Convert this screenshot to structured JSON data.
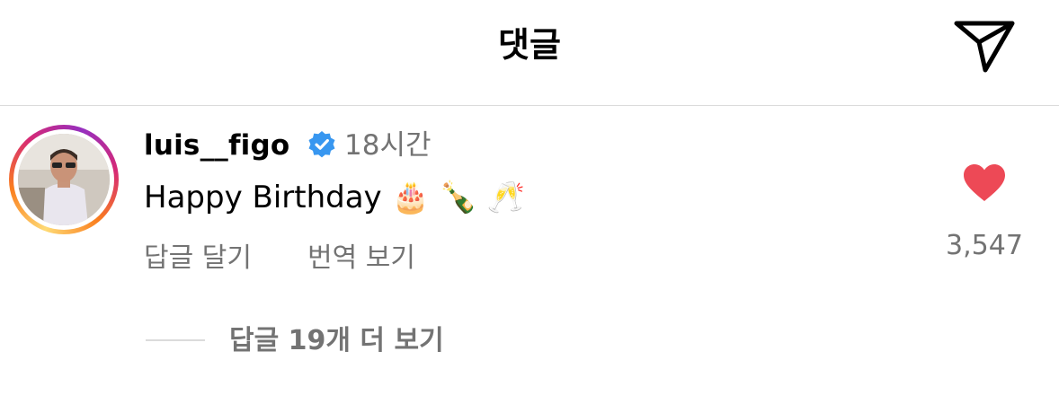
{
  "header": {
    "title": "댓글",
    "share_icon": "paper-plane-icon"
  },
  "comment": {
    "username": "luis__figo",
    "verified_icon": "verified-badge-icon",
    "time": "18시간",
    "text": "Happy Birthday 🎂 🍾 🥂",
    "reply_label": "답글 달기",
    "translate_label": "번역 보기",
    "like_icon": "heart-filled-icon",
    "like_count": "3,547",
    "view_replies_label": "답글 19개 더 보기"
  },
  "colors": {
    "like_red": "#ed4956",
    "verified_blue": "#3897f0",
    "secondary_text": "#737373"
  }
}
